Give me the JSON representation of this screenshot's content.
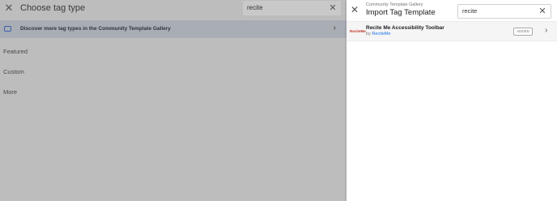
{
  "left_panel": {
    "title": "Choose tag type",
    "close_icon": "close-icon",
    "search": {
      "value": "recite"
    },
    "gallery_row": {
      "label": "Discover more tag types in the Community Template Gallery"
    },
    "sections": {
      "featured": "Featured",
      "custom": "Custom",
      "more": "More"
    }
  },
  "right_panel": {
    "subtitle": "Community Template Gallery",
    "title": "Import Tag Template",
    "search": {
      "value": "recite"
    },
    "results": [
      {
        "logo_text": "ReciteMe",
        "name": "Recite Me Accessibility Toolbar",
        "by_prefix": "by",
        "author": "ReciteMe",
        "badge": "ADDED"
      }
    ]
  },
  "colors": {
    "overlay": "#bdbdbd",
    "gallery_row": "#a9adb4",
    "link": "#1a73e8",
    "logo": "#c0392b"
  }
}
